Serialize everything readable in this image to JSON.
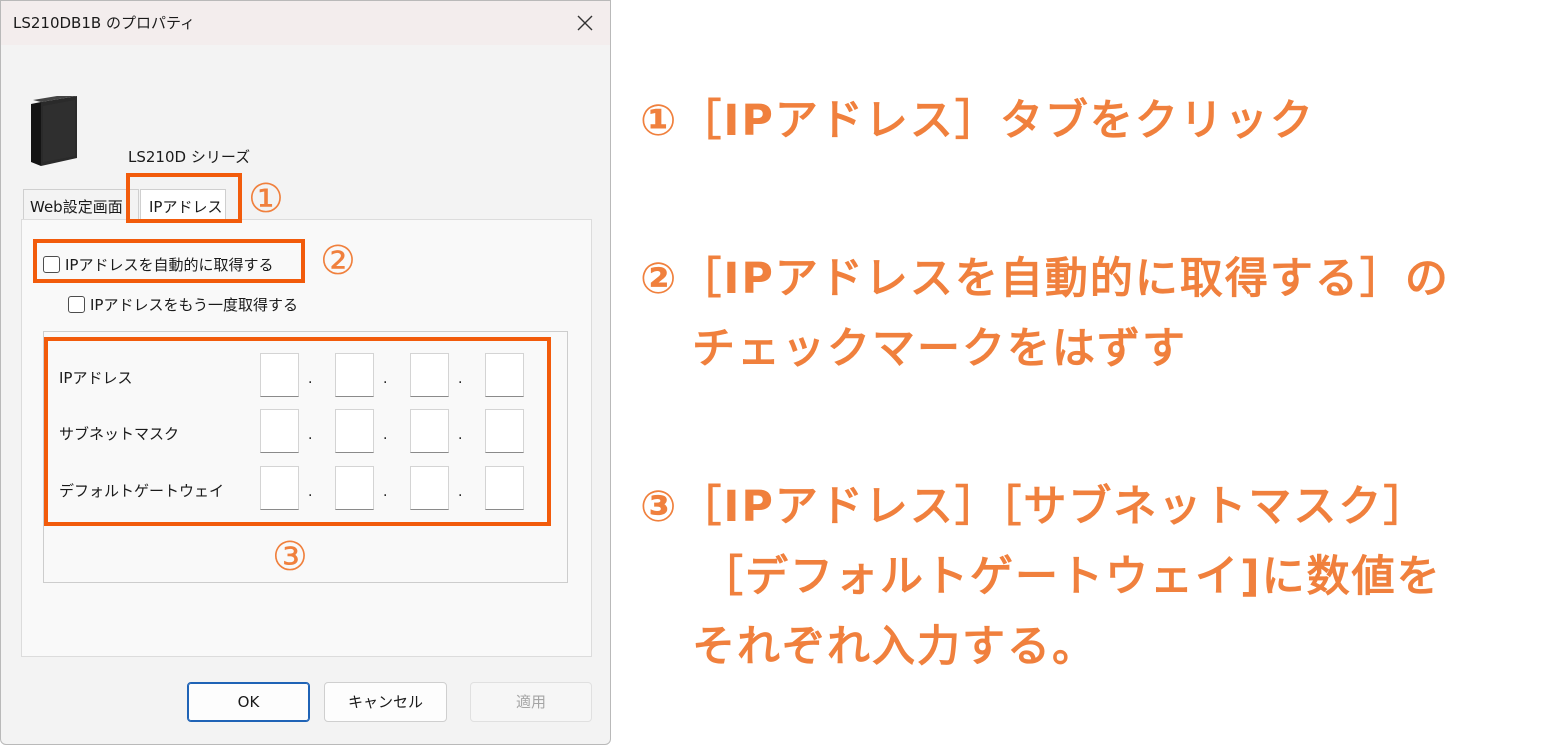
{
  "dialog": {
    "title": "LS210DB1B のプロパティ",
    "series_label": "LS210D シリーズ",
    "tabs": [
      {
        "label": "Web設定画面"
      },
      {
        "label": "IPアドレス"
      }
    ],
    "auto_ip_checkbox": {
      "label": "IPアドレスを自動的に取得する",
      "checked": false
    },
    "reacquire_checkbox": {
      "label": "IPアドレスをもう一度取得する",
      "checked": false
    },
    "fields": [
      {
        "label": "IPアドレス",
        "octets": [
          "",
          "",
          "",
          ""
        ]
      },
      {
        "label": "サブネットマスク",
        "octets": [
          "",
          "",
          "",
          ""
        ]
      },
      {
        "label": "デフォルトゲートウェイ",
        "octets": [
          "",
          "",
          "",
          ""
        ]
      }
    ],
    "buttons": {
      "ok": "OK",
      "cancel": "キャンセル",
      "apply": "適用"
    }
  },
  "markers": {
    "one": "①",
    "two": "②",
    "three": "③"
  },
  "instructions": {
    "step1": "①［IPアドレス］タブをクリック",
    "step2_line1": "②［IPアドレスを自動的に取得する］の",
    "step2_line2": "チェックマークをはずす",
    "step3_line1": "③［IPアドレス］［サブネットマスク］",
    "step3_line2": "［デフォルトゲートウェイ]に数値を",
    "step3_line3": "それぞれ入力する。"
  },
  "colors": {
    "highlight": "#f25b0b",
    "instruction_text": "#f0803d",
    "ok_border": "#1f63b6"
  }
}
